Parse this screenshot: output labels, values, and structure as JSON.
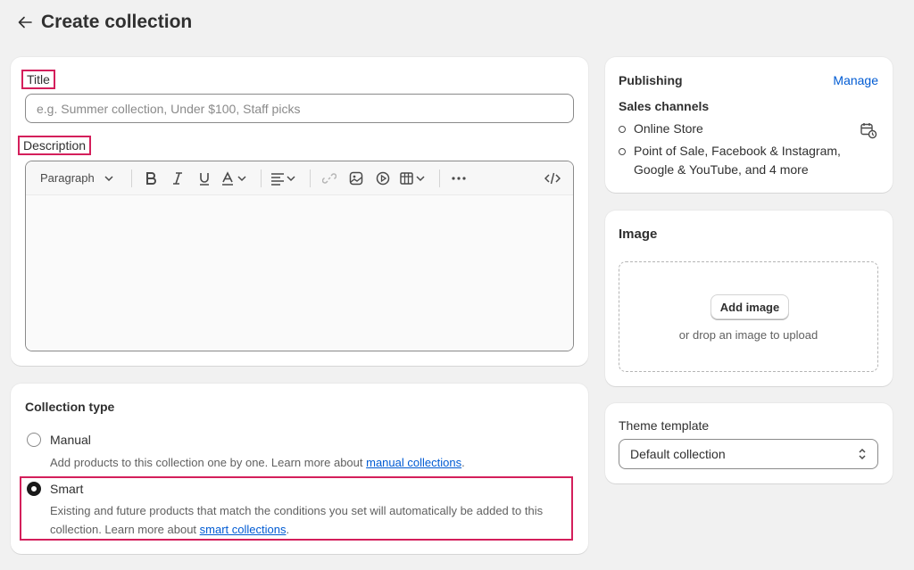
{
  "header": {
    "title": "Create collection"
  },
  "title_field": {
    "label": "Title",
    "placeholder": "e.g. Summer collection, Under $100, Staff picks",
    "value": ""
  },
  "description": {
    "label": "Description",
    "toolbar": {
      "paragraph_label": "Paragraph"
    }
  },
  "collection_type": {
    "heading": "Collection type",
    "manual": {
      "label": "Manual",
      "help": "Add products to this collection one by one. Learn more about ",
      "link": "manual collections",
      "suffix": "."
    },
    "smart": {
      "label": "Smart",
      "help": "Existing and future products that match the conditions you set will automatically be added to this collection. Learn more about ",
      "link": "smart collections",
      "suffix": ".",
      "selected": true
    }
  },
  "publishing": {
    "title": "Publishing",
    "manage_label": "Manage",
    "sales_heading": "Sales channels",
    "channels": [
      "Online Store",
      "Point of Sale, Facebook & Instagram, Google & YouTube, and 4 more"
    ]
  },
  "image": {
    "title": "Image",
    "button_label": "Add image",
    "hint": "or drop an image to upload"
  },
  "theme": {
    "label": "Theme template",
    "selected": "Default collection"
  },
  "colors": {
    "accent_link": "#005bd3",
    "highlight": "#d41f5b",
    "background": "#f1f1f1"
  },
  "icons": [
    "back-arrow-icon",
    "bold-icon",
    "italic-icon",
    "underline-icon",
    "text-color-icon",
    "align-icon",
    "link-icon",
    "image-icon",
    "video-icon",
    "table-icon",
    "more-icon",
    "code-icon",
    "calendar-schedule-icon",
    "select-arrows-icon"
  ]
}
